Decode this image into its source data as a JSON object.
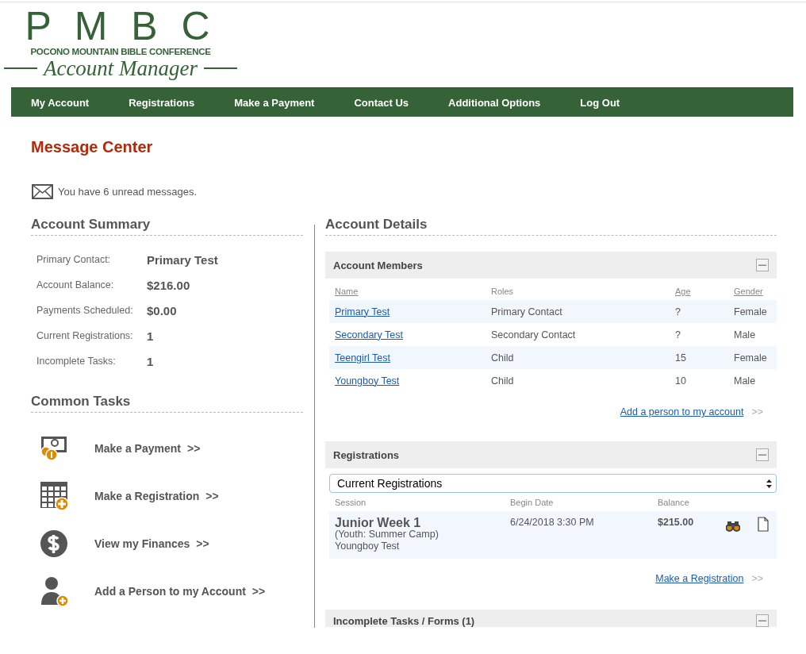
{
  "logo": {
    "letters": "P M B C",
    "name": "POCONO MOUNTAIN BIBLE CONFERENCE",
    "tagline": "Account Manager"
  },
  "nav": [
    {
      "label": "My Account"
    },
    {
      "label": "Registrations"
    },
    {
      "label": "Make a Payment"
    },
    {
      "label": "Contact Us"
    },
    {
      "label": "Additional Options"
    },
    {
      "label": "Log Out"
    }
  ],
  "message_center": {
    "title": "Message Center",
    "text": "You have 6 unread messages."
  },
  "account_summary": {
    "title": "Account Summary",
    "rows": [
      {
        "label": "Primary Contact:",
        "value": "Primary Test"
      },
      {
        "label": "Account Balance:",
        "value": "$216.00"
      },
      {
        "label": "Payments Scheduled:",
        "value": "$0.00"
      },
      {
        "label": "Current Registrations:",
        "value": "1"
      },
      {
        "label": "Incomplete Tasks:",
        "value": "1"
      }
    ]
  },
  "common_tasks": {
    "title": "Common Tasks",
    "items": [
      {
        "kind": "payment",
        "label": "Make a Payment",
        "arrow": ">>"
      },
      {
        "kind": "registration",
        "label": "Make a Registration",
        "arrow": ">>"
      },
      {
        "kind": "finances",
        "label": "View my Finances",
        "arrow": ">>"
      },
      {
        "kind": "person",
        "label": "Add a Person to my Account",
        "arrow": ">>"
      }
    ]
  },
  "account_details": {
    "title": "Account Details",
    "members": {
      "title": "Account Members",
      "columns": [
        {
          "label": "Name",
          "sortable": true
        },
        {
          "label": "Roles",
          "sortable": false
        },
        {
          "label": "Age",
          "sortable": true
        },
        {
          "label": "Gender",
          "sortable": true
        }
      ],
      "rows": [
        {
          "name": "Primary Test",
          "role": "Primary Contact",
          "age": "?",
          "gender": "Female"
        },
        {
          "name": "Secondary Test",
          "role": "Secondary Contact",
          "age": "?",
          "gender": "Male"
        },
        {
          "name": "Teengirl Test",
          "role": "Child",
          "age": "15",
          "gender": "Female"
        },
        {
          "name": "Youngboy Test",
          "role": "Child",
          "age": "10",
          "gender": "Male"
        }
      ],
      "link": "Add a person to my account",
      "link_arrow": ">>"
    },
    "registrations": {
      "title": "Registrations",
      "filter": "Current Registrations",
      "columns": [
        {
          "label": "Session"
        },
        {
          "label": "Begin Date"
        },
        {
          "label": "Balance"
        }
      ],
      "rows": [
        {
          "session": "Junior Week 1",
          "category": "(Youth: Summer Camp)",
          "person": "Youngboy Test",
          "begin_date": "6/24/2018 3:30 PM",
          "balance": "$215.00"
        }
      ],
      "link": "Make a Registration",
      "link_arrow": ">>"
    },
    "tasks": {
      "title": "Incomplete Tasks / Forms (1)"
    }
  }
}
